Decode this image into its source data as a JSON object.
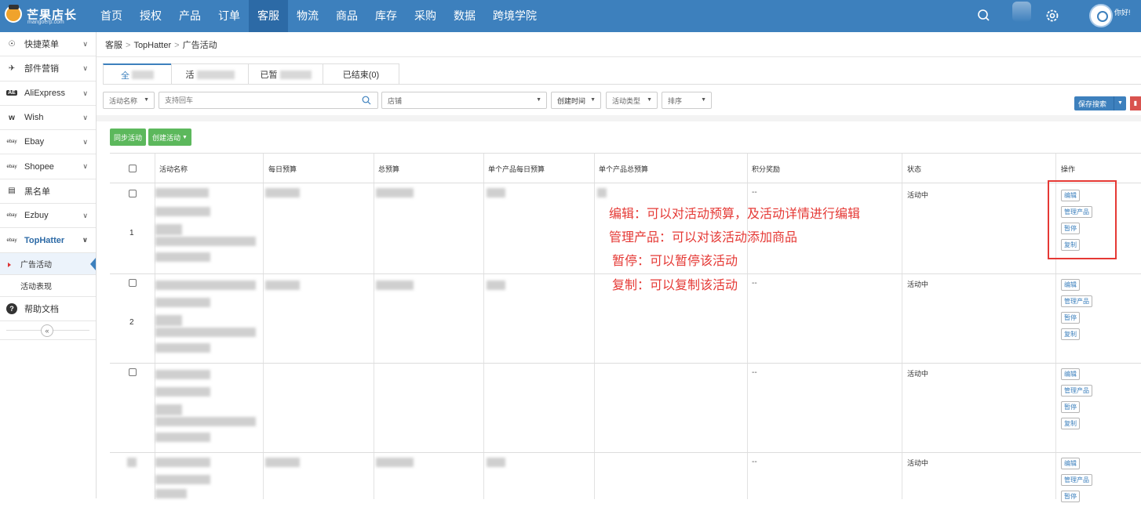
{
  "logo": {
    "title": "芒果店长",
    "subtitle": "mangoerp.com"
  },
  "nav": {
    "items": [
      "首页",
      "授权",
      "产品",
      "订单",
      "客服",
      "物流",
      "商品",
      "库存",
      "采购",
      "数据",
      "跨境学院"
    ],
    "active_index": 4,
    "greeting": "你好!"
  },
  "sidebar": {
    "items": [
      {
        "icon": "☉",
        "label": "快捷菜单",
        "chevron": true
      },
      {
        "icon": "✈",
        "label": "部件营销",
        "chevron": true
      },
      {
        "icon": "AE",
        "label": "AliExpress",
        "chevron": true
      },
      {
        "icon": "w",
        "label": "Wish",
        "chevron": true
      },
      {
        "icon": "ebay",
        "label": "Ebay",
        "chevron": true
      },
      {
        "icon": "ebay",
        "label": "Shopee",
        "chevron": true
      },
      {
        "icon": "▤",
        "label": "黑名单",
        "chevron": false
      },
      {
        "icon": "ebay",
        "label": "Ezbuy",
        "chevron": true
      },
      {
        "icon": "ebay",
        "label": "TopHatter",
        "chevron": true
      }
    ],
    "sub_items": [
      "广告活动",
      "活动表现"
    ],
    "help": "帮助文档",
    "collapse": "«"
  },
  "breadcrumb": [
    "客服",
    "TopHatter",
    "广告活动"
  ],
  "tabs": [
    {
      "label": "全"
    },
    {
      "label": "活"
    },
    {
      "label": "已暂"
    },
    {
      "label": "已结束(0)"
    }
  ],
  "filters": {
    "activity_name": "活动名称",
    "search_placeholder": "支持回车",
    "shop": "店铺",
    "created_time": "创建时间",
    "activity_type": "活动类型",
    "sort": "排序"
  },
  "buttons": {
    "save_search": "保存搜索",
    "sync": "同步活动",
    "create": "创建活动"
  },
  "table": {
    "headers": [
      "活动名称",
      "每日预算",
      "总预算",
      "单个产品每日预算",
      "单个产品总预算",
      "积分奖励",
      "状态",
      "操作"
    ],
    "rows": [
      {
        "no": "1",
        "points": "--",
        "status": "活动中"
      },
      {
        "no": "2",
        "points": "--",
        "status": "活动中"
      },
      {
        "no": "",
        "points": "--",
        "status": "活动中"
      },
      {
        "no": "",
        "points": "--",
        "status": "活动中"
      }
    ],
    "ops": [
      "编辑",
      "管理产品",
      "暂停",
      "复制"
    ]
  },
  "annotations": [
    "编辑：可以对活动预算，及活动详情进行编辑",
    "管理产品：可以对该活动添加商品",
    "暂停：可以暂停该活动",
    "复制：可以复制该活动"
  ],
  "colors": {
    "nav": "#3d80bd",
    "nav_active": "#2c6aa6",
    "green": "#5cb85c",
    "annotation": "#e53935"
  }
}
